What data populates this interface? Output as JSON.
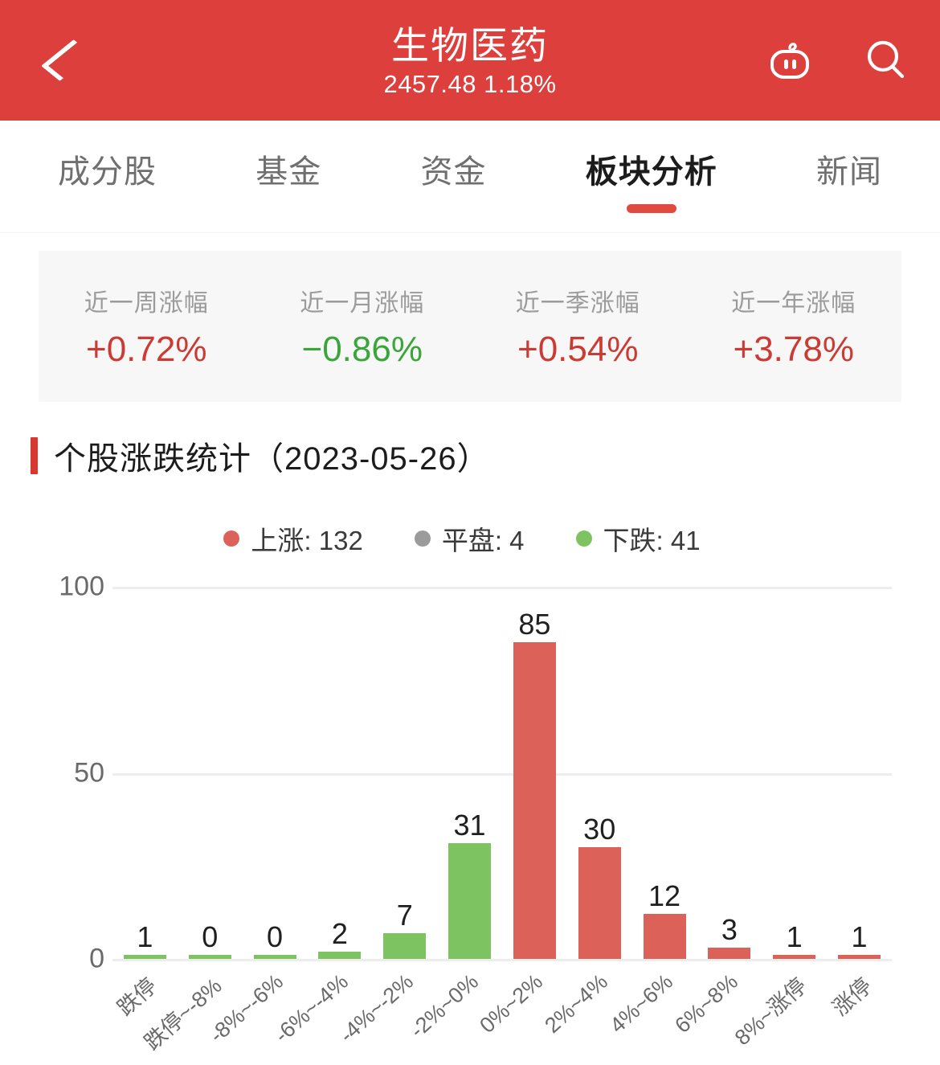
{
  "header": {
    "title": "生物医药",
    "subtitle": "2457.48 1.18%",
    "back_icon": "chevron-left-icon",
    "robot_icon": "robot-icon",
    "search_icon": "search-icon",
    "background_color": "#dc3f3c"
  },
  "tabs": [
    {
      "label": "成分股",
      "active": false
    },
    {
      "label": "基金",
      "active": false
    },
    {
      "label": "资金",
      "active": false
    },
    {
      "label": "板块分析",
      "active": true
    },
    {
      "label": "新闻",
      "active": false
    }
  ],
  "stats": [
    {
      "label": "近一周涨幅",
      "value": "+0.72%",
      "direction": "up"
    },
    {
      "label": "近一月涨幅",
      "value": "−0.86%",
      "direction": "down"
    },
    {
      "label": "近一季涨幅",
      "value": "+0.54%",
      "direction": "up"
    },
    {
      "label": "近一年涨幅",
      "value": "+3.78%",
      "direction": "up"
    }
  ],
  "section": {
    "title": "个股涨跌统计（2023-05-26）"
  },
  "colors": {
    "up_red": "#dc6259",
    "flat_gray": "#9b9b9b",
    "down_green": "#7dc361",
    "accent": "#d8382f",
    "grid": "#ededed"
  },
  "chart_data": {
    "type": "bar",
    "title": "个股涨跌统计（2023-05-26）",
    "xlabel": "",
    "ylabel": "",
    "ylim": [
      0,
      100
    ],
    "yticks": [
      0,
      50,
      100
    ],
    "grid": true,
    "legend_position": "top-center",
    "legend": [
      {
        "name": "上涨",
        "value": 132,
        "color": "#dc6259"
      },
      {
        "name": "平盘",
        "value": 4,
        "color": "#9b9b9b"
      },
      {
        "name": "下跌",
        "value": 41,
        "color": "#7dc361"
      }
    ],
    "categories": [
      "跌停",
      "跌停~-8%",
      "-8%~-6%",
      "-6%~-4%",
      "-4%~-2%",
      "-2%~0%",
      "0%~2%",
      "2%~4%",
      "4%~6%",
      "6%~8%",
      "8%~涨停",
      "涨停"
    ],
    "values": [
      1,
      0,
      0,
      2,
      7,
      31,
      85,
      30,
      12,
      3,
      1,
      1
    ],
    "bar_colors": [
      "#7dc361",
      "#7dc361",
      "#7dc361",
      "#7dc361",
      "#7dc361",
      "#7dc361",
      "#dc6259",
      "#dc6259",
      "#dc6259",
      "#dc6259",
      "#dc6259",
      "#dc6259"
    ]
  }
}
